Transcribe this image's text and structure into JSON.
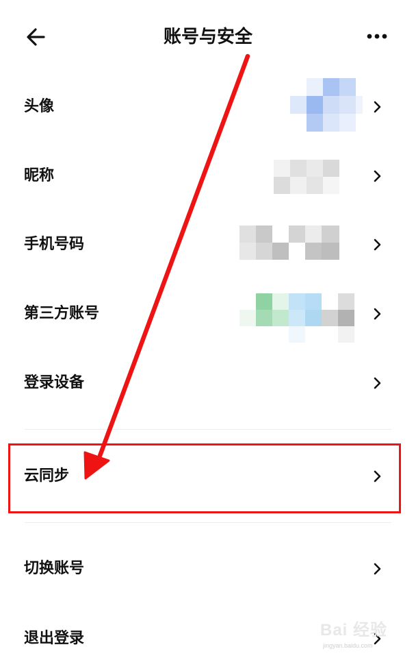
{
  "header": {
    "title": "账号与安全",
    "back_icon": "back-arrow-icon",
    "more_icon": "more-dots-icon"
  },
  "rows": [
    {
      "label": "头像",
      "value": "blurred avatar"
    },
    {
      "label": "昵称",
      "value": "blurred nickname"
    },
    {
      "label": "手机号码",
      "value": "blurred phone number"
    },
    {
      "label": "第三方账号",
      "value": "blurred linked accounts"
    },
    {
      "label": "登录设备"
    },
    {
      "label": "云同步"
    },
    {
      "label": "切换账号"
    },
    {
      "label": "退出登录"
    }
  ],
  "annotation": {
    "arrow_color": "#ef1414",
    "highlight_color": "#ef1414",
    "highlighted_item": "云同步"
  },
  "watermark": {
    "brand": "Bai 经验",
    "url": "jingyan.baidu.com"
  },
  "colors": {
    "background": "#ffffff",
    "text": "#111111",
    "divider": "#ececec"
  }
}
